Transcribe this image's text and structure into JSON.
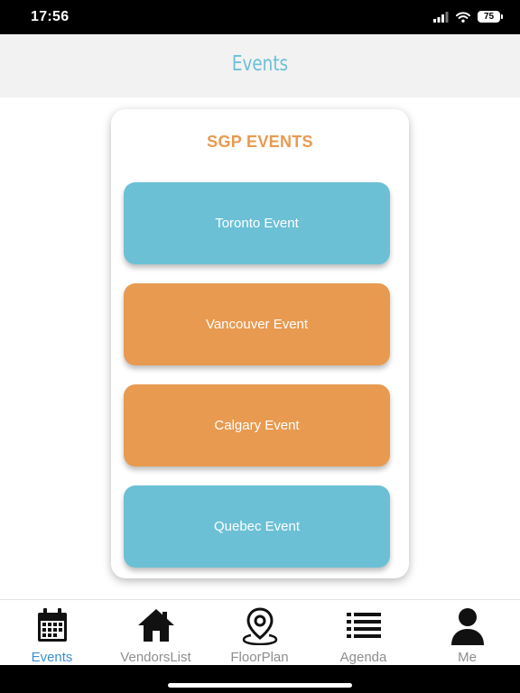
{
  "status_bar": {
    "time": "17:56",
    "battery": "75"
  },
  "header": {
    "title": "Events"
  },
  "card": {
    "title": "SGP EVENTS"
  },
  "events": [
    {
      "label": "Toronto Event",
      "color": "#6cc0d5"
    },
    {
      "label": "Vancouver Event",
      "color": "#e89a50"
    },
    {
      "label": "Calgary Event",
      "color": "#e89a50"
    },
    {
      "label": "Quebec Event",
      "color": "#6cc0d5"
    }
  ],
  "tabs": [
    {
      "label": "Events",
      "icon": "calendar-icon",
      "active": true
    },
    {
      "label": "VendorsList",
      "icon": "home-icon",
      "active": false
    },
    {
      "label": "FloorPlan",
      "icon": "map-pin-icon",
      "active": false
    },
    {
      "label": "Agenda",
      "icon": "list-icon",
      "active": false
    },
    {
      "label": "Me",
      "icon": "person-icon",
      "active": false
    }
  ],
  "colors": {
    "accent_blue": "#6cc0d5",
    "accent_orange": "#e89a50",
    "active_tab": "#3a8fd6"
  }
}
